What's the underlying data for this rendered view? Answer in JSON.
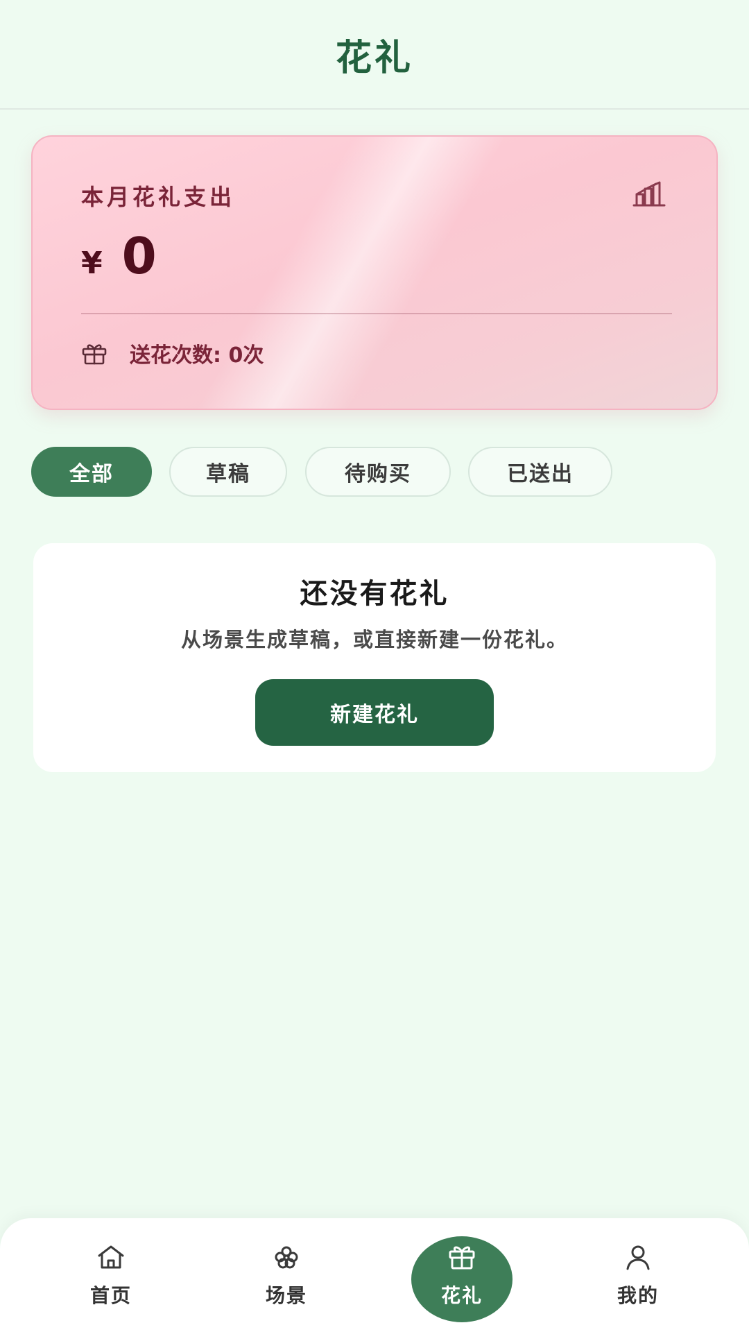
{
  "header": {
    "title": "花礼"
  },
  "spend_card": {
    "label": "本月花礼支出",
    "currency": "¥",
    "amount": "0",
    "send_count_text": "送花次数: 0次",
    "chart_icon": "bar-chart-icon",
    "gift_icon": "gift-icon"
  },
  "filters": [
    {
      "label": "全部",
      "active": true
    },
    {
      "label": "草稿",
      "active": false
    },
    {
      "label": "待购买",
      "active": false
    },
    {
      "label": "已送出",
      "active": false
    }
  ],
  "empty_state": {
    "title": "还没有花礼",
    "description": "从场景生成草稿，或直接新建一份花礼。",
    "button_label": "新建花礼"
  },
  "bottom_nav": [
    {
      "label": "首页",
      "icon": "home-icon",
      "active": false
    },
    {
      "label": "场景",
      "icon": "flower-icon",
      "active": false
    },
    {
      "label": "花礼",
      "icon": "gift-icon",
      "active": true
    },
    {
      "label": "我的",
      "icon": "user-icon",
      "active": false
    }
  ],
  "colors": {
    "background": "#eefbf1",
    "primary_green": "#256443",
    "active_green": "#3e7e58",
    "card_pink": "#fbc8d2",
    "pink_text": "#7a2438"
  }
}
